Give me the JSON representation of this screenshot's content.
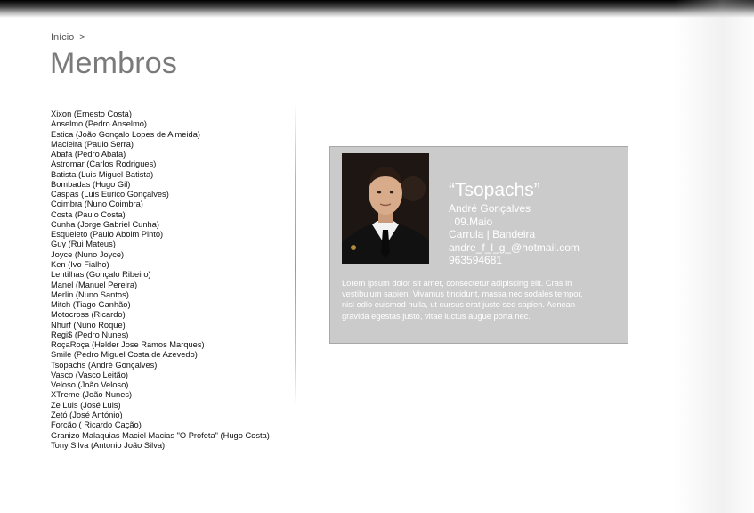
{
  "breadcrumb": {
    "home": "Início",
    "separator": ">"
  },
  "page": {
    "title": "Membros"
  },
  "members": [
    "Xixon (Ernesto Costa)",
    "Anselmo (Pedro Anselmo)",
    "Estica (João Gonçalo Lopes de Almeida)",
    "Macieira (Paulo Serra)",
    "Abafa (Pedro Abafa)",
    "Astromar (Carlos Rodrigues)",
    "Batista (Luis Miguel Batista)",
    "Bombadas (Hugo Gil)",
    "Caspas (Luis Eurico Gonçalves)",
    "Coimbra (Nuno Coimbra)",
    "Costa (Paulo Costa)",
    "Cunha (Jorge Gabriel Cunha)",
    "Esqueleto (Paulo Aboim Pinto)",
    "Guy (Rui Mateus)",
    "Joyce (Nuno Joyce)",
    "Ken (Ivo Fialho)",
    "Lentilhas (Gonçalo Ribeiro)",
    "Manel (Manuel Pereira)",
    "Merlin (Nuno Santos)",
    "Mitch (Tiago Ganhão)",
    "Motocross (Ricardo)",
    "Nhurf (Nuno Roque)",
    "Regi$ (Pedro Nunes)",
    "RoçaRoça (Helder Jose Ramos Marques)",
    "Smile (Pedro Miguel Costa de Azevedo)",
    "Tsopachs (André Gonçalves)",
    "Vasco (Vasco Leitão)",
    "Veloso (João Veloso)",
    "XTreme (João Nunes)",
    "Ze Luis (José Luis)",
    "Zetó (José António)",
    "Forcão ( Ricardo Cação)",
    "Granizo Malaquias Maciel Macias \"O Profeta\" (Hugo Costa)",
    "Tony Silva (Antonio João Silva)"
  ],
  "profile": {
    "nickname": "“Tsopachs”",
    "name": "André Gonçalves",
    "birthday": "| 09.Maio",
    "location": "Carrula | Bandeira",
    "email": "andre_f_l_g_@hotmail.com",
    "phone": "963594681",
    "bio": "Lorem ipsum dolor sit amet, consectetur adipiscing elit. Cras in vestibulum sapien. Vivamus tincidunt, massa nec sodales tempor, nisl odio euismod nulla, ut cursus erat justo sed sapien. Aenean gravida egestas justo, vitae luctus augue porta nec."
  },
  "colors": {
    "card_background": "#cbcbcb",
    "title_gray": "#7a7a7a",
    "card_text": "#ffffff"
  }
}
